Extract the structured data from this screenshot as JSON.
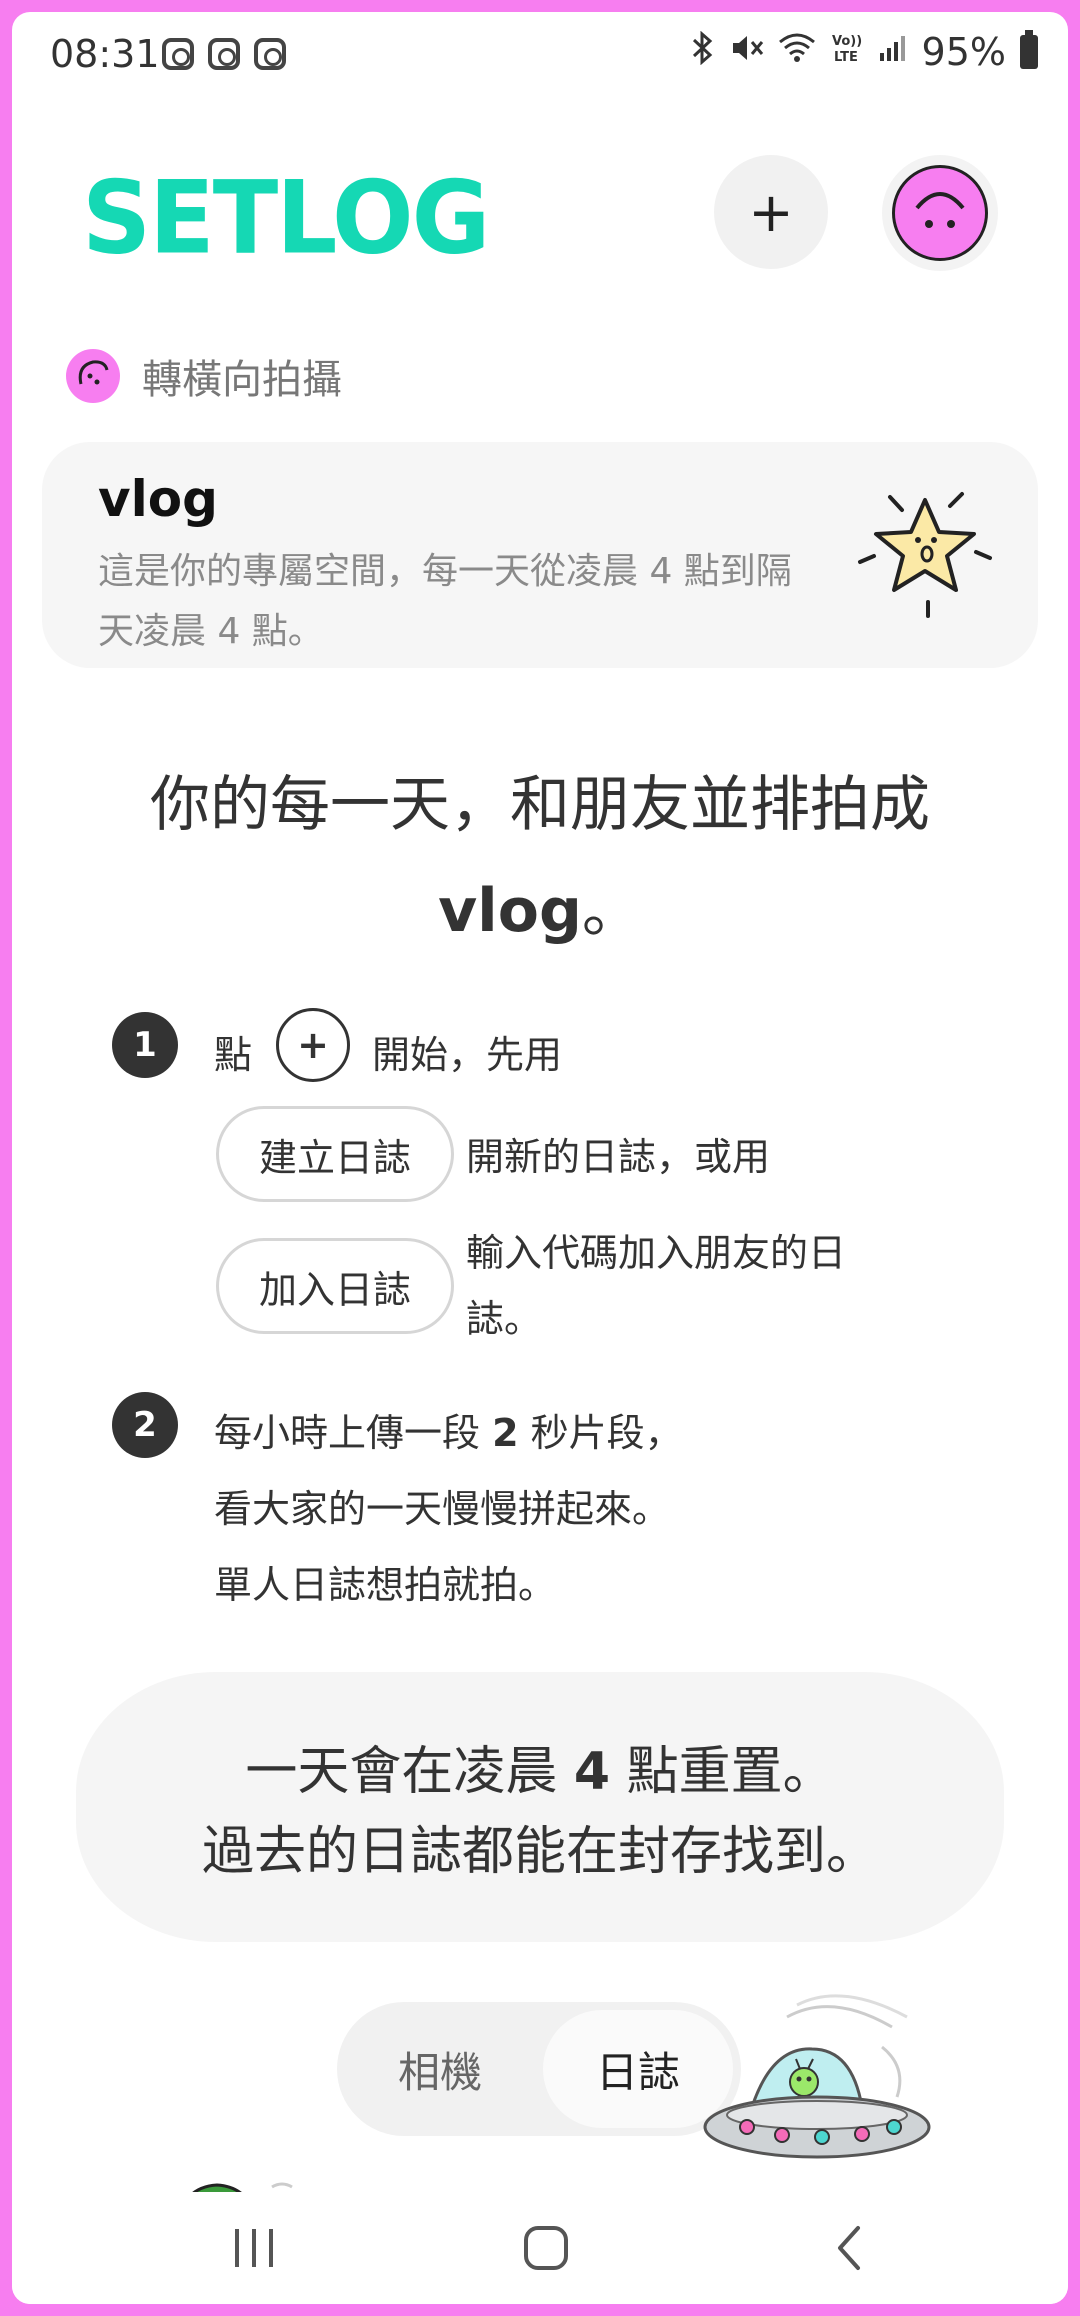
{
  "status_bar": {
    "time": "08:31",
    "battery": "95%",
    "icons": [
      "instagram-icon",
      "instagram-icon",
      "instagram-icon",
      "bluetooth-icon",
      "mute-icon",
      "wifi-icon",
      "volte-icon",
      "signal-icon",
      "battery-icon"
    ]
  },
  "header": {
    "logo": "SETLOG",
    "add_label": "+"
  },
  "rotate_hint": {
    "label": "轉橫向拍攝"
  },
  "vlog_card": {
    "title": "vlog",
    "description": "這是你的專屬空間，每一天從凌晨 4 點到隔天凌晨 4 點。"
  },
  "headline": {
    "line1": "你的每一天，和朋友並排拍成",
    "line2_bold": "vlog",
    "line2_tail": "。"
  },
  "steps": {
    "step1": {
      "number": "1",
      "tap": "點",
      "plus": "+",
      "start": "開始，先用",
      "create_btn": "建立日誌",
      "create_desc": "開新的日誌，或用",
      "join_btn": "加入日誌",
      "join_desc_1": "輸入代碼加入朋友的日",
      "join_desc_2": "誌。"
    },
    "step2": {
      "number": "2",
      "line1_a": "每小時上傳一段",
      "line1_num": "2",
      "line1_b": "秒片段，",
      "line2": "看大家的一天慢慢拼起來。",
      "line3": "單人日誌想拍就拍。"
    }
  },
  "reset_note": {
    "line1_a": "一天會在凌晨",
    "line1_num": "4",
    "line1_b": "點重置。",
    "line2": "過去的日誌都能在封存找到。"
  },
  "segmented": {
    "camera": "相機",
    "journal": "日誌",
    "selected": "日誌"
  },
  "colors": {
    "brand": "#15d8b4",
    "accent_pink": "#f77ef0",
    "card_bg": "#f6f6f6"
  }
}
